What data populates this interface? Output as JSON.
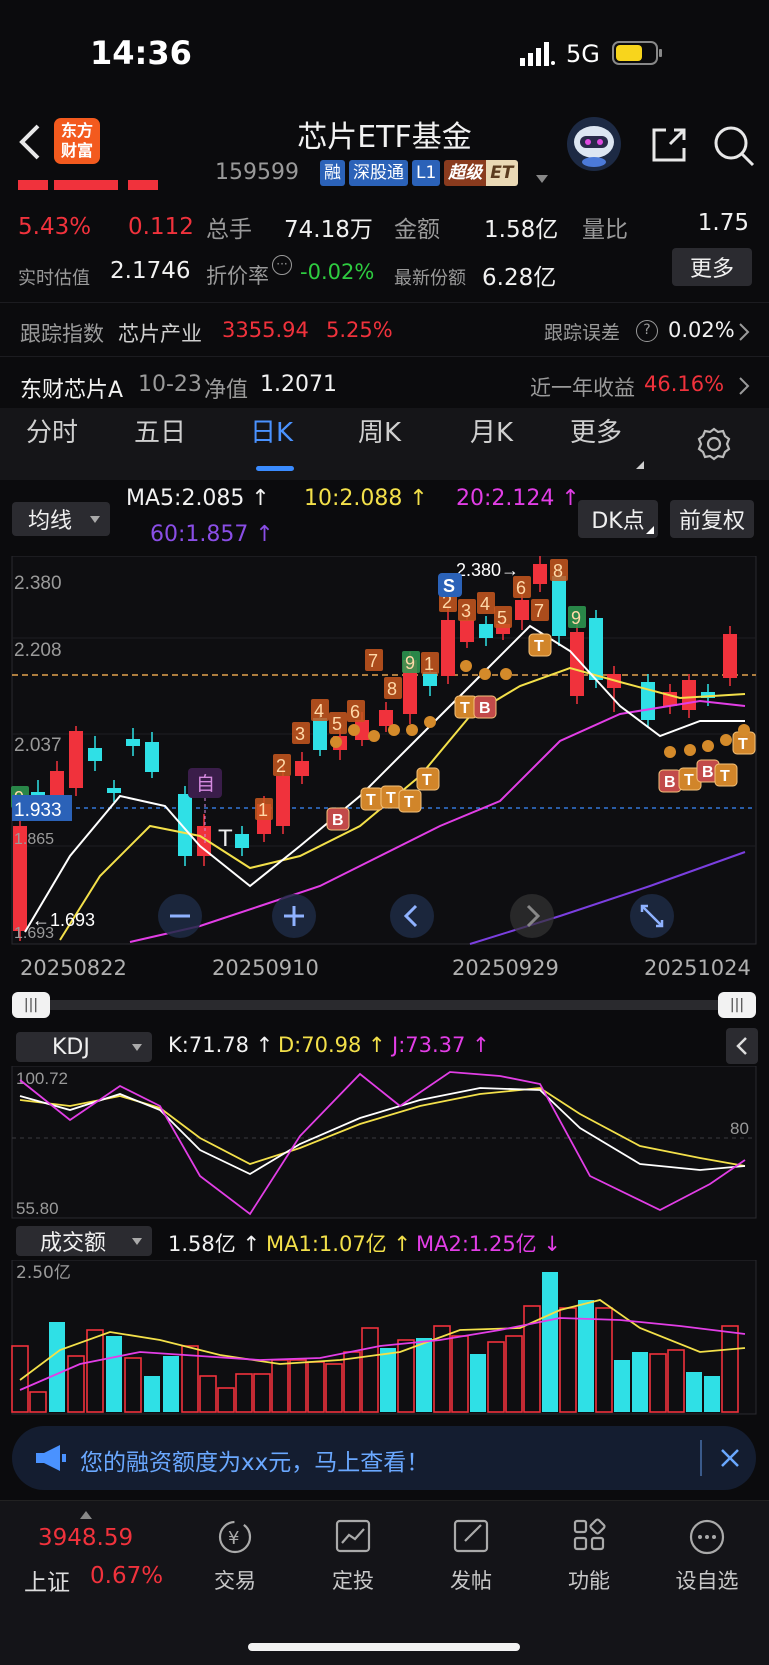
{
  "status_bar": {
    "time": "14:36",
    "network": "5G"
  },
  "header": {
    "title": "芯片ETF基金",
    "code": "159599",
    "tags": [
      "融",
      "深股通",
      "L1",
      "超级",
      "ET"
    ],
    "brand_line1": "东方",
    "brand_line2": "财富"
  },
  "quote": {
    "change_pct": "5.43%",
    "change_amt": "0.112",
    "volume_label": "总手",
    "volume": "74.18万",
    "amount_label": "金额",
    "amount": "1.58亿",
    "ratio_label": "量比",
    "ratio": "1.75",
    "est_label": "实时估值",
    "est_value": "2.1746",
    "premium_label": "折价率",
    "premium_value": "-0.02%",
    "shares_label": "最新份额",
    "shares_value": "6.28亿",
    "more_label": "更多"
  },
  "tracking": {
    "label": "跟踪指数",
    "index_name": "芯片产业",
    "index_value": "3355.94",
    "index_pct": "5.25%",
    "error_label": "跟踪误差",
    "error_value": "0.02%"
  },
  "fund": {
    "name": "东财芯片A",
    "date": "10-23",
    "nav_label": "净值",
    "nav": "1.2071",
    "year_label": "近一年收益",
    "year_value": "46.16%"
  },
  "tabs": [
    "分时",
    "五日",
    "日K",
    "周K",
    "月K",
    "更多"
  ],
  "ma_legend": {
    "selector": "均线",
    "ma5": "MA5:2.085",
    "ma10": "10:2.088",
    "ma20": "20:2.124",
    "ma60": "60:1.857",
    "dk_button": "DK点",
    "fq_button": "前复权"
  },
  "kline": {
    "y_labels": [
      "2.380",
      "2.208",
      "2.037",
      "1.933",
      "1.865",
      "1.693"
    ],
    "high_mark": "2.380",
    "low_mark": "1.693",
    "x_labels": [
      "20250822",
      "20250910",
      "20250929",
      "20251024"
    ],
    "self_tag": "自",
    "signal_S": "S"
  },
  "kdj": {
    "selector": "KDJ",
    "k": "K:71.78",
    "d": "D:70.98",
    "j": "J:73.37",
    "y_top": "100.72",
    "y_mid": "80",
    "y_bottom": "55.80"
  },
  "volume_panel": {
    "selector": "成交额",
    "value": "1.58亿",
    "ma1": "MA1:1.07亿",
    "ma2": "MA2:1.25亿",
    "y_top": "2.50亿"
  },
  "banner": {
    "text": "您的融资额度为xx元，马上查看！"
  },
  "bottom_nav": {
    "index_value": "3948.59",
    "index_name": "上证",
    "index_pct": "0.67%",
    "items": [
      "交易",
      "定投",
      "发帖",
      "功能",
      "设自选"
    ]
  },
  "colors": {
    "up": "#f0323c",
    "down": "#2fe0e6",
    "ma5": "#ffffff",
    "ma10": "#f3e04a",
    "ma20": "#e23ee6",
    "ma60": "#7b3fe0",
    "accent": "#3a8bff"
  }
}
